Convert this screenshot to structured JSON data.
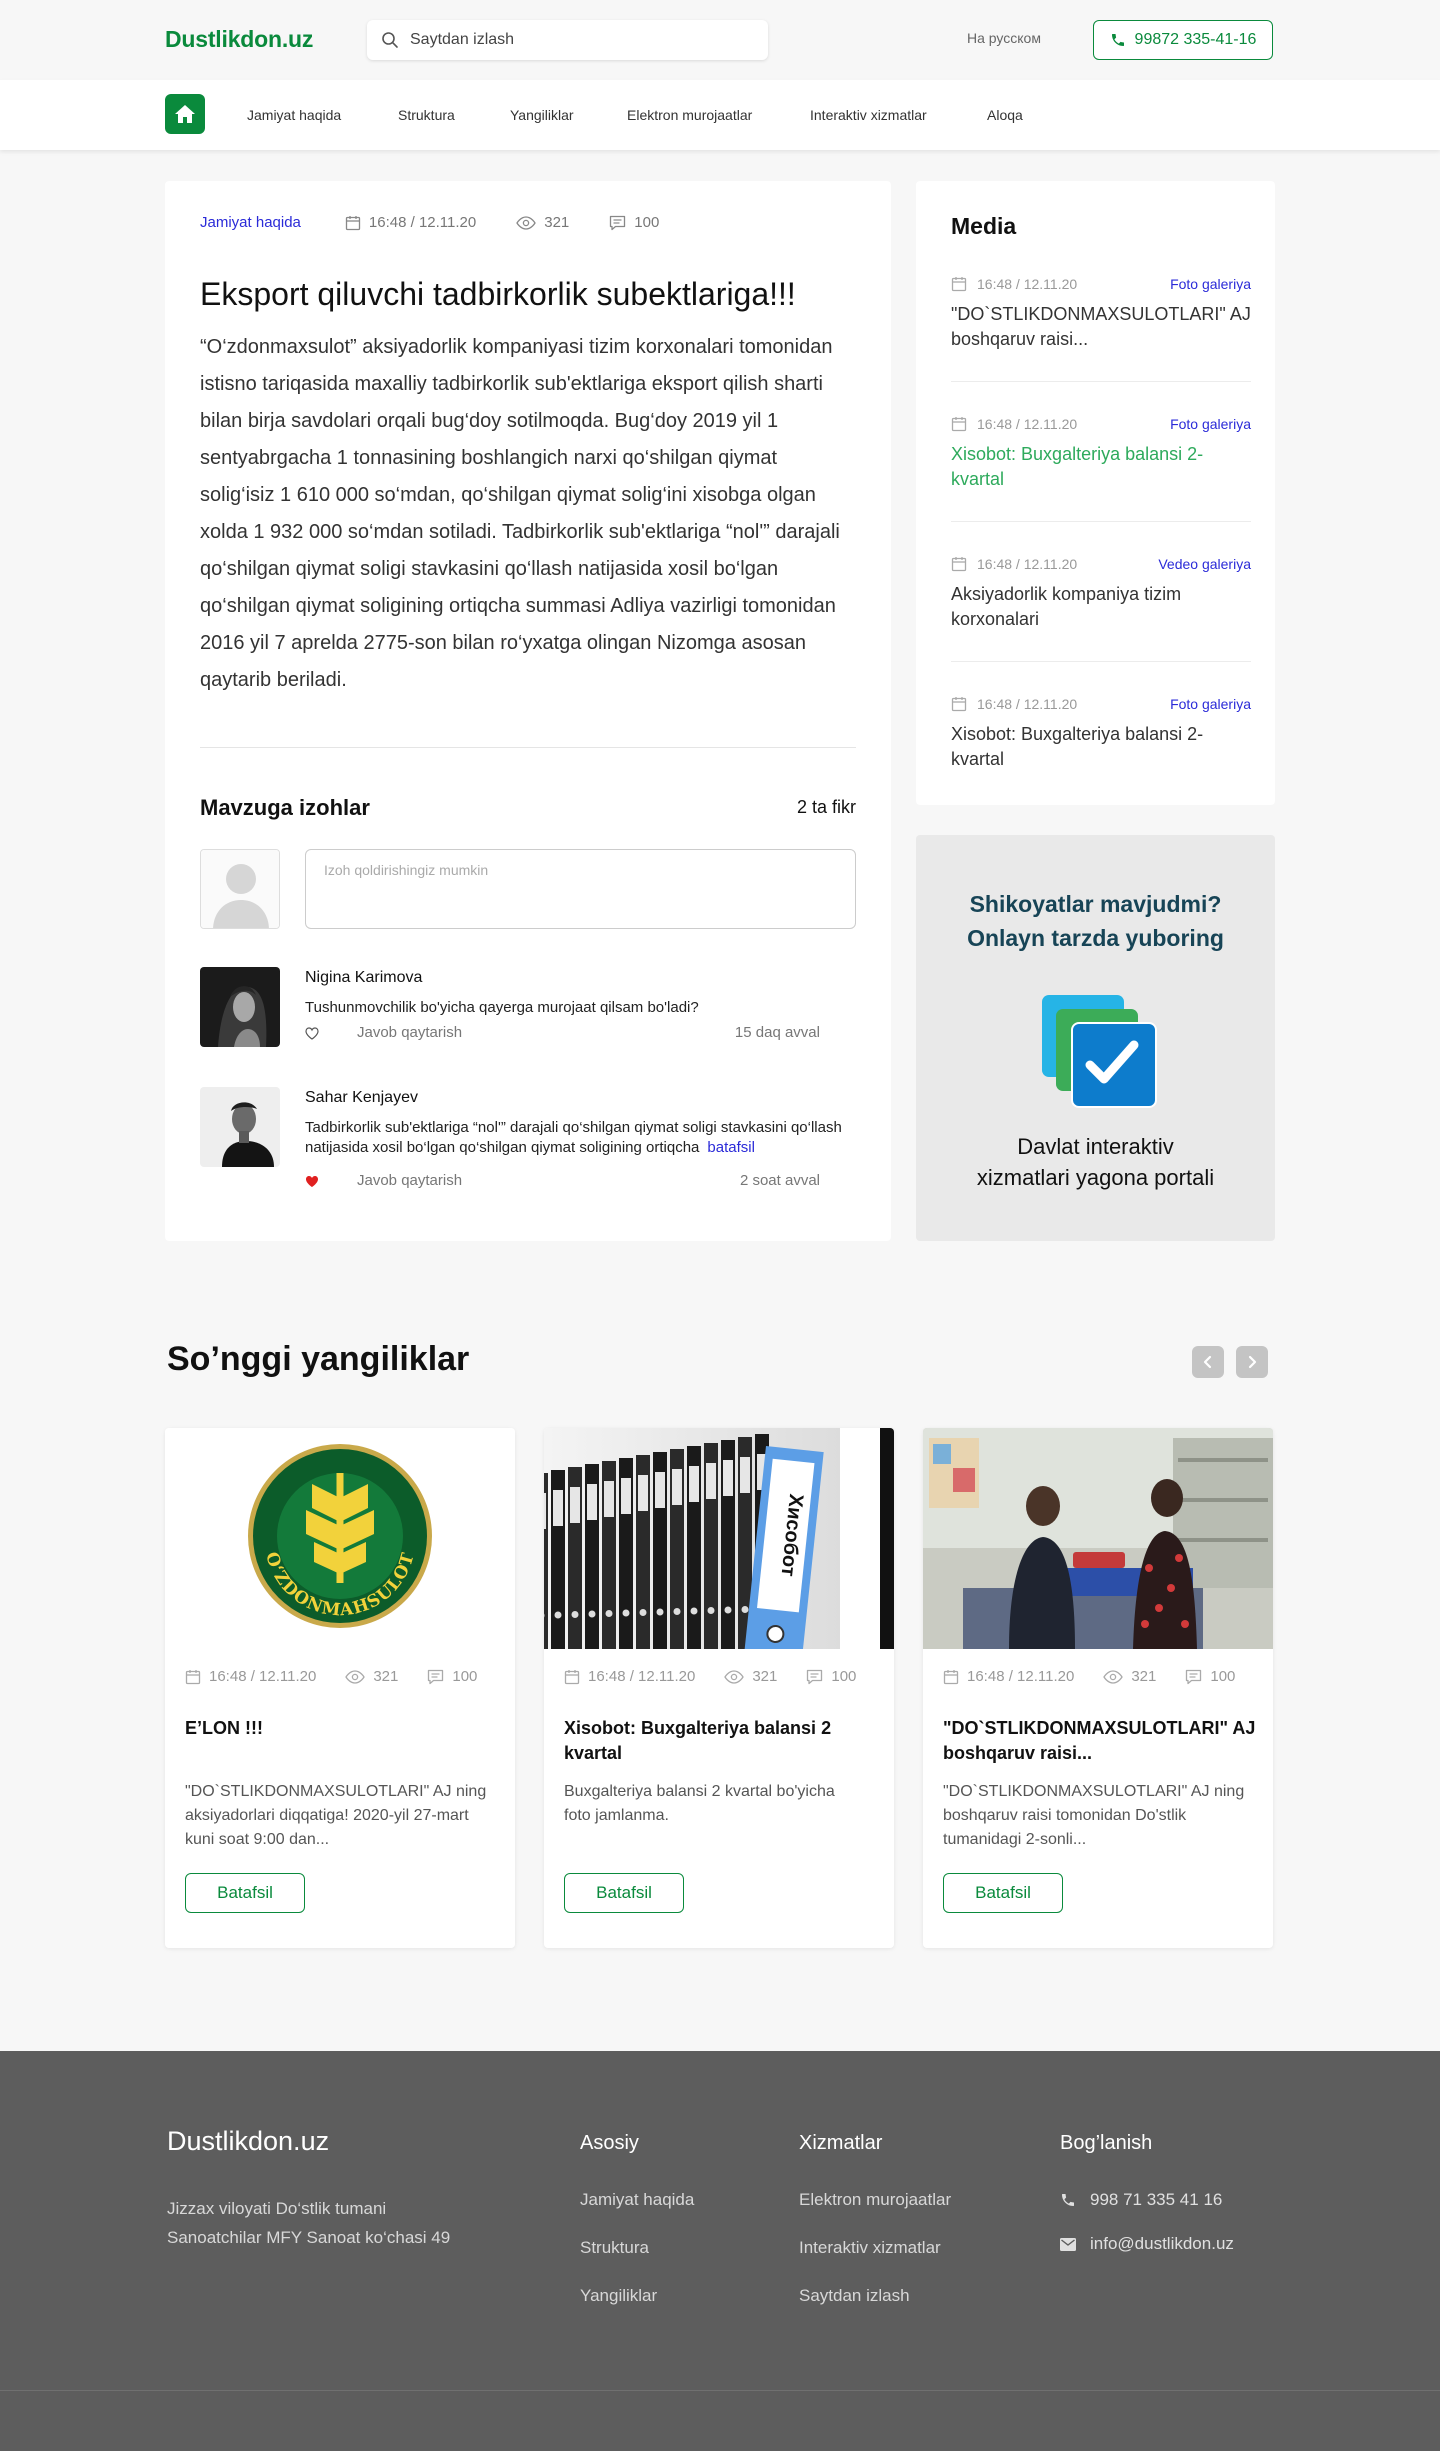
{
  "header": {
    "logo": "Dustlikdon.uz",
    "search_placeholder": "Saytdan izlash",
    "lang": "На русском",
    "phone": "99872 335-41-16"
  },
  "nav": {
    "items": [
      "Jamiyat haqida",
      "Struktura",
      "Yangiliklar",
      "Elektron murojaatlar",
      "Interaktiv xizmatlar",
      "Aloqa"
    ]
  },
  "article": {
    "category": "Jamiyat haqida",
    "date": "16:48 / 12.11.20",
    "views": "321",
    "comments": "100",
    "title": "Eksport qiluvchi tadbirkorlik subektlariga!!!",
    "body": "“O‘zdonmaxsulot” aksiyadorlik kompaniyasi tizim korxonalari tomonidan istisno tariqasida maxalliy tadbirkorlik sub'ektlariga eksport qilish sharti bilan birja savdolari orqali bug‘doy sotilmoqda. Bug‘doy 2019 yil 1 sentyabrgacha 1 tonnasining boshlangich narxi qo‘shilgan qiymat solig‘isiz 1 610 000 so‘mdan, qo‘shilgan qiymat solig‘ini xisobga olgan xolda 1 932 000 so‘mdan sotiladi. Tadbirkorlik sub'ektlariga “nol'” darajali qo‘shilgan qiymat soligi stavkasini qo‘llash natijasida xosil bo‘lgan qo‘shilgan qiymat soligining ortiqcha summasi Adliya vazirligi tomonidan 2016 yil 7 aprelda 2775-son bilan ro‘yxatga olingan Nizomga asosan qaytarib beriladi."
  },
  "comments": {
    "heading": "Mavzuga izohlar",
    "count": "2 ta fikr",
    "input_placeholder": "Izoh qoldirishingiz mumkin",
    "reply_label": "Javob qaytarish",
    "more_label": "batafsil",
    "items": [
      {
        "name": "Nigina Karimova",
        "text": "Tushunmovchilik bo'yicha qayerga murojaat qilsam bo'ladi?",
        "time": "15 daq avval",
        "liked": false
      },
      {
        "name": "Sahar Kenjayev",
        "text": "Tadbirkorlik sub'ektlariga “nol'” darajali qo‘shilgan qiymat soligi stavkasini qo‘llash natijasida xosil bo‘lgan qo‘shilgan qiymat soligining ortiqcha",
        "time": "2 soat avval",
        "liked": true
      }
    ]
  },
  "media": {
    "title": "Media",
    "items": [
      {
        "date": "16:48 / 12.11.20",
        "category": "Foto galeriya",
        "title": "\"DO`STLIKDONMAXSULOTLARI\" AJ boshqaruv raisi...",
        "active": false
      },
      {
        "date": "16:48 / 12.11.20",
        "category": "Foto galeriya",
        "title": "Xisobot: Buxgalteriya balansi 2-kvartal",
        "active": true
      },
      {
        "date": "16:48 / 12.11.20",
        "category": "Vedeo galeriya",
        "title": "Aksiyadorlik kompaniya tizim korxonalari",
        "active": false
      },
      {
        "date": "16:48 / 12.11.20",
        "category": "Foto galeriya",
        "title": "Xisobot: Buxgalteriya balansi 2-kvartal",
        "active": false
      }
    ]
  },
  "promo": {
    "title_line1": "Shikoyatlar mavjudmi?",
    "title_line2": "Onlayn tarzda yuboring",
    "sub_line1": "Davlat interaktiv",
    "sub_line2": "xizmatlari yagona portali"
  },
  "news": {
    "title": "So’nggi yangiliklar",
    "button_label": "Batafsil",
    "emblem_text": "O‘ZDONMAHSULOT",
    "folder_text": "Хисобот",
    "cards": [
      {
        "date": "16:48 / 12.11.20",
        "views": "321",
        "comments": "100",
        "title": "E’LON !!!",
        "desc": "\"DO`STLIKDONMAXSULOTLARI\" AJ ning aksiyadorlari diqqatiga! 2020-yil 27-mart kuni soat 9:00 dan..."
      },
      {
        "date": "16:48 / 12.11.20",
        "views": "321",
        "comments": "100",
        "title": "Xisobot: Buxgalteriya balansi 2 kvartal",
        "desc": "Buxgalteriya balansi 2 kvartal bo'yicha foto jamlanma."
      },
      {
        "date": "16:48 / 12.11.20",
        "views": "321",
        "comments": "100",
        "title": "\"DO`STLIKDONMAXSULOTLARI\" AJ boshqaruv raisi...",
        "desc": "\"DO`STLIKDONMAXSULOTLARI\" AJ ning boshqaruv raisi tomonidan Do'stlik tumanidagi 2-sonli..."
      }
    ]
  },
  "footer": {
    "logo": "Dustlikdon.uz",
    "address_line1": "Jizzax viloyati Do‘stlik tumani",
    "address_line2": "Sanoatchilar MFY Sanoat ko‘chasi 49",
    "col1": {
      "title": "Asosiy",
      "links": [
        "Jamiyat haqida",
        "Struktura",
        "Yangiliklar"
      ]
    },
    "col2": {
      "title": "Xizmatlar",
      "links": [
        "Elektron murojaatlar",
        "Interaktiv xizmatlar",
        "Saytdan izlash"
      ]
    },
    "col3": {
      "title": "Bog’lanish",
      "phone": "998 71 335 41 16",
      "email": "info@dustlikdon.uz"
    }
  },
  "colors": {
    "brand_green": "#0a8a3c",
    "link_blue": "#2b2bd8",
    "active_green": "#2eaa5c",
    "footer_bg": "#5d5d5d",
    "promo_title": "#174456"
  }
}
